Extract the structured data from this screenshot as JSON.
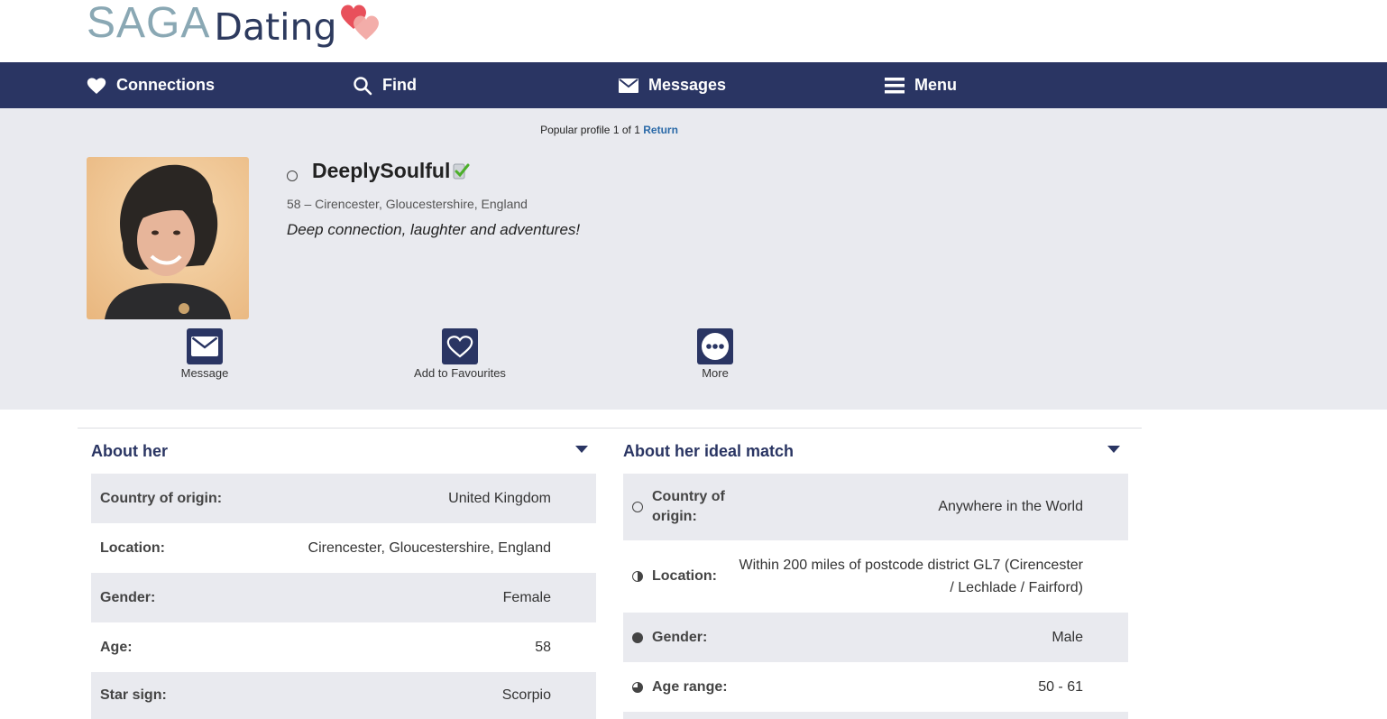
{
  "logo": {
    "saga": "SAGA",
    "dating": "Dating"
  },
  "nav": {
    "connections": "Connections",
    "find": "Find",
    "messages": "Messages",
    "menu": "Menu"
  },
  "popular": {
    "prefix": "Popular profile",
    "n1": "1",
    "of": "of",
    "n2": "1",
    "return_label": "Return"
  },
  "profile": {
    "username": "DeeplySoulful",
    "meta": "58 – Cirencester, Gloucestershire, England",
    "tagline": "Deep connection, laughter and adventures!"
  },
  "actions": {
    "message": "Message",
    "favourite": "Add to Favourites",
    "more": "More"
  },
  "about_her": {
    "title": "About her",
    "rows": [
      {
        "label": "Country of origin:",
        "value": "United Kingdom"
      },
      {
        "label": "Location:",
        "value": "Cirencester, Gloucestershire, England"
      },
      {
        "label": "Gender:",
        "value": "Female"
      },
      {
        "label": "Age:",
        "value": "58"
      },
      {
        "label": "Star sign:",
        "value": "Scorpio"
      }
    ]
  },
  "ideal_match": {
    "title": "About her ideal match",
    "rows": [
      {
        "label_line1": "Country of",
        "label_line2": "origin:",
        "value": "Anywhere in the World",
        "indicator": "empty"
      },
      {
        "label": "Location:",
        "value_line1": "Within 200 miles of postcode district GL7 (Cirencester",
        "value_line2": "/ Lechlade / Fairford)",
        "indicator": "half"
      },
      {
        "label": "Gender:",
        "value": "Male",
        "indicator": "full"
      },
      {
        "label": "Age range:",
        "value": "50 - 61",
        "indicator": "three-quarter"
      }
    ]
  },
  "colors": {
    "nav": "#2a3563",
    "band": "#e9eaef",
    "link": "#2b6aa8",
    "logo_saga": "#8aa8b4",
    "heart": "#e8505b"
  }
}
